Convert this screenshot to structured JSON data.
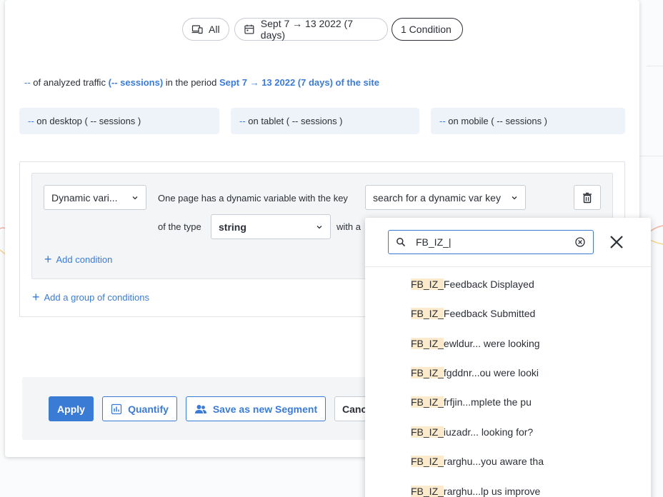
{
  "filters": {
    "all_label": "All",
    "date_label": "Sept 7 → 13 2022 (7 days)",
    "condition_label": "1 Condition"
  },
  "summary": {
    "value": "--",
    "text1": "of analyzed traffic",
    "sessions": "(-- sessions)",
    "text2": "in the period",
    "period": "Sept 7 → 13 2022 (7 days) of the site"
  },
  "devices": [
    {
      "value": "--",
      "label": "on desktop ( -- sessions )"
    },
    {
      "value": "--",
      "label": "on tablet ( -- sessions )"
    },
    {
      "value": "--",
      "label": "on mobile ( -- sessions )"
    }
  ],
  "condition": {
    "type_select": "Dynamic vari...",
    "sentence1": "One page has a dynamic variable with the key",
    "key_select": "search for a dynamic var key",
    "sentence2": "of the type",
    "type_value": "string",
    "sentence3": "with a",
    "add_condition": "Add condition",
    "add_group": "Add a group of conditions"
  },
  "footer": {
    "apply": "Apply",
    "quantify": "Quantify",
    "save_segment": "Save as new Segment",
    "cancel": "Canc"
  },
  "dropdown": {
    "search_value": "FB_IZ_|",
    "match_prefix": "FB_IZ_",
    "items": [
      "Feedback Displayed",
      "Feedback Submitted",
      "ewldur... were looking",
      "fgddnr...ou were looki",
      "frfjin...mplete the pu",
      "iuzadr... looking for?",
      "rarghu...you aware tha",
      "rarghu...lp us improve"
    ]
  },
  "colors": {
    "accent": "#3a7bd5",
    "highlight": "#fbeacb"
  }
}
